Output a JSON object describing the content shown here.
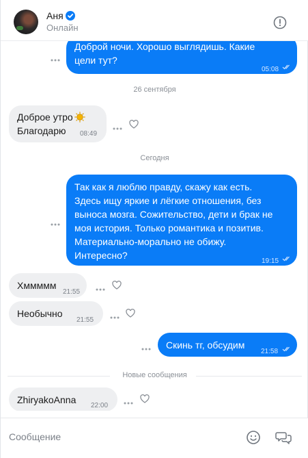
{
  "header": {
    "name": "Аня",
    "status": "Онлайн",
    "verified_icon": "verified-check-icon",
    "info_icon": "alert-circle-icon"
  },
  "messages": [
    {
      "id": "m1",
      "dir": "out",
      "text": "Доброй ночи. Хорошо выглядишь. Какие\nцели тут?",
      "time": "05:08",
      "read": true
    },
    {
      "id": "sep1",
      "type": "date",
      "text": "26 сентября"
    },
    {
      "id": "m2",
      "dir": "in",
      "text": "Доброе утро",
      "text2": "Благодарю",
      "emoji": "sun-emoji",
      "time": "08:49"
    },
    {
      "id": "sep2",
      "type": "date",
      "text": "Сегодня"
    },
    {
      "id": "m3",
      "dir": "out",
      "text": "Так как я люблю правду, скажу как есть.\nЗдесь ищу яркие и лёгкие отношения, без\nвыноса мозга. Сожительство, дети и брак не\nмоя история. Только романтика и позитив.\nМатериально-морально не обижу.\nИнтересно?",
      "time": "19:15",
      "read": true
    },
    {
      "id": "m4",
      "dir": "in",
      "text": "Хммммм",
      "time": "21:55"
    },
    {
      "id": "m5",
      "dir": "in",
      "text": "Необычно",
      "time": "21:55"
    },
    {
      "id": "m6",
      "dir": "out",
      "text": "Скинь тг, обсудим",
      "time": "21:58",
      "read": true
    },
    {
      "id": "m7",
      "dir": "in",
      "text": "ZhiryakoAnna",
      "time": "22:00"
    }
  ],
  "new_messages_label": "Новые сообщения",
  "composer": {
    "placeholder": "Сообщение",
    "emoji_icon": "smile-icon",
    "send_icon": "chat-bubbles-icon"
  },
  "colors": {
    "outgoing": "#0a7cf7",
    "incoming": "#eeeff1",
    "accent": "#0a7cf7"
  }
}
